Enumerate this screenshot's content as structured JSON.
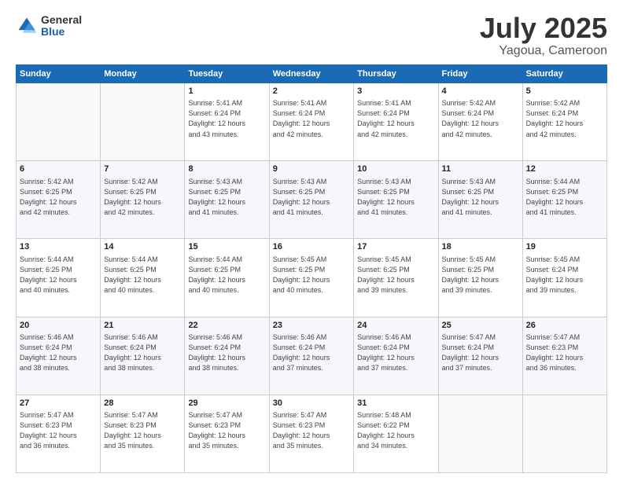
{
  "header": {
    "logo": {
      "general": "General",
      "blue": "Blue"
    },
    "title": "July 2025",
    "location": "Yagoua, Cameroon"
  },
  "weekdays": [
    "Sunday",
    "Monday",
    "Tuesday",
    "Wednesday",
    "Thursday",
    "Friday",
    "Saturday"
  ],
  "weeks": [
    [
      {
        "day": "",
        "info": ""
      },
      {
        "day": "",
        "info": ""
      },
      {
        "day": "1",
        "info": "Sunrise: 5:41 AM\nSunset: 6:24 PM\nDaylight: 12 hours\nand 43 minutes."
      },
      {
        "day": "2",
        "info": "Sunrise: 5:41 AM\nSunset: 6:24 PM\nDaylight: 12 hours\nand 42 minutes."
      },
      {
        "day": "3",
        "info": "Sunrise: 5:41 AM\nSunset: 6:24 PM\nDaylight: 12 hours\nand 42 minutes."
      },
      {
        "day": "4",
        "info": "Sunrise: 5:42 AM\nSunset: 6:24 PM\nDaylight: 12 hours\nand 42 minutes."
      },
      {
        "day": "5",
        "info": "Sunrise: 5:42 AM\nSunset: 6:24 PM\nDaylight: 12 hours\nand 42 minutes."
      }
    ],
    [
      {
        "day": "6",
        "info": "Sunrise: 5:42 AM\nSunset: 6:25 PM\nDaylight: 12 hours\nand 42 minutes."
      },
      {
        "day": "7",
        "info": "Sunrise: 5:42 AM\nSunset: 6:25 PM\nDaylight: 12 hours\nand 42 minutes."
      },
      {
        "day": "8",
        "info": "Sunrise: 5:43 AM\nSunset: 6:25 PM\nDaylight: 12 hours\nand 41 minutes."
      },
      {
        "day": "9",
        "info": "Sunrise: 5:43 AM\nSunset: 6:25 PM\nDaylight: 12 hours\nand 41 minutes."
      },
      {
        "day": "10",
        "info": "Sunrise: 5:43 AM\nSunset: 6:25 PM\nDaylight: 12 hours\nand 41 minutes."
      },
      {
        "day": "11",
        "info": "Sunrise: 5:43 AM\nSunset: 6:25 PM\nDaylight: 12 hours\nand 41 minutes."
      },
      {
        "day": "12",
        "info": "Sunrise: 5:44 AM\nSunset: 6:25 PM\nDaylight: 12 hours\nand 41 minutes."
      }
    ],
    [
      {
        "day": "13",
        "info": "Sunrise: 5:44 AM\nSunset: 6:25 PM\nDaylight: 12 hours\nand 40 minutes."
      },
      {
        "day": "14",
        "info": "Sunrise: 5:44 AM\nSunset: 6:25 PM\nDaylight: 12 hours\nand 40 minutes."
      },
      {
        "day": "15",
        "info": "Sunrise: 5:44 AM\nSunset: 6:25 PM\nDaylight: 12 hours\nand 40 minutes."
      },
      {
        "day": "16",
        "info": "Sunrise: 5:45 AM\nSunset: 6:25 PM\nDaylight: 12 hours\nand 40 minutes."
      },
      {
        "day": "17",
        "info": "Sunrise: 5:45 AM\nSunset: 6:25 PM\nDaylight: 12 hours\nand 39 minutes."
      },
      {
        "day": "18",
        "info": "Sunrise: 5:45 AM\nSunset: 6:25 PM\nDaylight: 12 hours\nand 39 minutes."
      },
      {
        "day": "19",
        "info": "Sunrise: 5:45 AM\nSunset: 6:24 PM\nDaylight: 12 hours\nand 39 minutes."
      }
    ],
    [
      {
        "day": "20",
        "info": "Sunrise: 5:46 AM\nSunset: 6:24 PM\nDaylight: 12 hours\nand 38 minutes."
      },
      {
        "day": "21",
        "info": "Sunrise: 5:46 AM\nSunset: 6:24 PM\nDaylight: 12 hours\nand 38 minutes."
      },
      {
        "day": "22",
        "info": "Sunrise: 5:46 AM\nSunset: 6:24 PM\nDaylight: 12 hours\nand 38 minutes."
      },
      {
        "day": "23",
        "info": "Sunrise: 5:46 AM\nSunset: 6:24 PM\nDaylight: 12 hours\nand 37 minutes."
      },
      {
        "day": "24",
        "info": "Sunrise: 5:46 AM\nSunset: 6:24 PM\nDaylight: 12 hours\nand 37 minutes."
      },
      {
        "day": "25",
        "info": "Sunrise: 5:47 AM\nSunset: 6:24 PM\nDaylight: 12 hours\nand 37 minutes."
      },
      {
        "day": "26",
        "info": "Sunrise: 5:47 AM\nSunset: 6:23 PM\nDaylight: 12 hours\nand 36 minutes."
      }
    ],
    [
      {
        "day": "27",
        "info": "Sunrise: 5:47 AM\nSunset: 6:23 PM\nDaylight: 12 hours\nand 36 minutes."
      },
      {
        "day": "28",
        "info": "Sunrise: 5:47 AM\nSunset: 6:23 PM\nDaylight: 12 hours\nand 35 minutes."
      },
      {
        "day": "29",
        "info": "Sunrise: 5:47 AM\nSunset: 6:23 PM\nDaylight: 12 hours\nand 35 minutes."
      },
      {
        "day": "30",
        "info": "Sunrise: 5:47 AM\nSunset: 6:23 PM\nDaylight: 12 hours\nand 35 minutes."
      },
      {
        "day": "31",
        "info": "Sunrise: 5:48 AM\nSunset: 6:22 PM\nDaylight: 12 hours\nand 34 minutes."
      },
      {
        "day": "",
        "info": ""
      },
      {
        "day": "",
        "info": ""
      }
    ]
  ]
}
